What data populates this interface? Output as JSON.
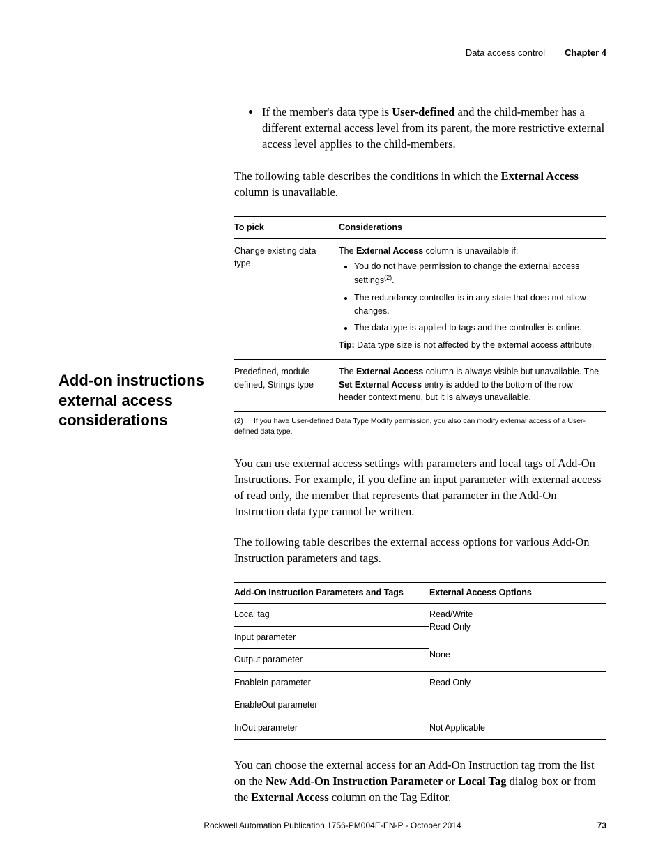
{
  "header": {
    "section": "Data access control",
    "chapter": "Chapter 4"
  },
  "top_bullet": {
    "prefix": "If the member's data type is ",
    "bold1": "User-defined",
    "rest": " and the child-member has a different external access level from its parent, the more restrictive external access level applies to the child-members."
  },
  "intro_para": {
    "p1a": "The following table describes the conditions in which the ",
    "p1b": "External Access",
    "p1c": " column is unavailable."
  },
  "table1": {
    "head_col1": "To pick",
    "head_col2": "Considerations",
    "row1": {
      "col1": "Change existing data type",
      "lead_a": "The ",
      "lead_b": "External Access",
      "lead_c": " column is unavailable if:",
      "b1_a": "You do not have permission to change the external access settings",
      "b1_sup": "(2)",
      "b1_b": ".",
      "b2": "The redundancy controller is in any state that does not allow changes.",
      "b3": "The data type is applied to tags and the controller is online.",
      "tip_label": "Tip:",
      "tip_text": " Data type size is not affected by the external access attribute."
    },
    "row2": {
      "col1": "Predefined, module-defined, Strings type",
      "a": "The ",
      "b": "External Access",
      "c": " column is always visible but unavailable. The ",
      "d": "Set External Access",
      "e": " entry is added to the bottom of the row header context menu, but it is always unavailable."
    }
  },
  "footnote": {
    "num": "(2)",
    "text": "If you have User-defined Data Type Modify permission, you also can modify external access of a User-defined data type."
  },
  "left_heading": "Add-on instructions external access considerations",
  "body2": {
    "p1": "You can use external access settings with parameters and local tags of Add-On Instructions. For example, if you define an input parameter with external access of read only, the member that represents that parameter in the Add-On Instruction data type cannot be written.",
    "p2": "The following table describes the external access options for various Add-On Instruction parameters and tags."
  },
  "table2": {
    "head_col1": "Add-On Instruction Parameters and Tags",
    "head_col2": "External Access Options",
    "rows_left": [
      "Local tag",
      "Input parameter",
      "Output parameter",
      "EnableIn parameter",
      "EnableOut parameter",
      "InOut parameter"
    ],
    "group1_lines": [
      "Read/Write",
      "Read Only",
      "None"
    ],
    "group2_text": "Read Only",
    "group3_text": "Not Applicable"
  },
  "body3": {
    "a": "You can choose the external access for an Add-On Instruction tag from the list on the ",
    "b": "New Add-On Instruction Parameter",
    "c": " or ",
    "d": "Local Tag",
    "e": " dialog box or from the ",
    "f": "External Access",
    "g": " column on the Tag Editor."
  },
  "footer": {
    "publication": "Rockwell Automation Publication 1756-PM004E-EN-P - October 2014",
    "page": "73"
  }
}
